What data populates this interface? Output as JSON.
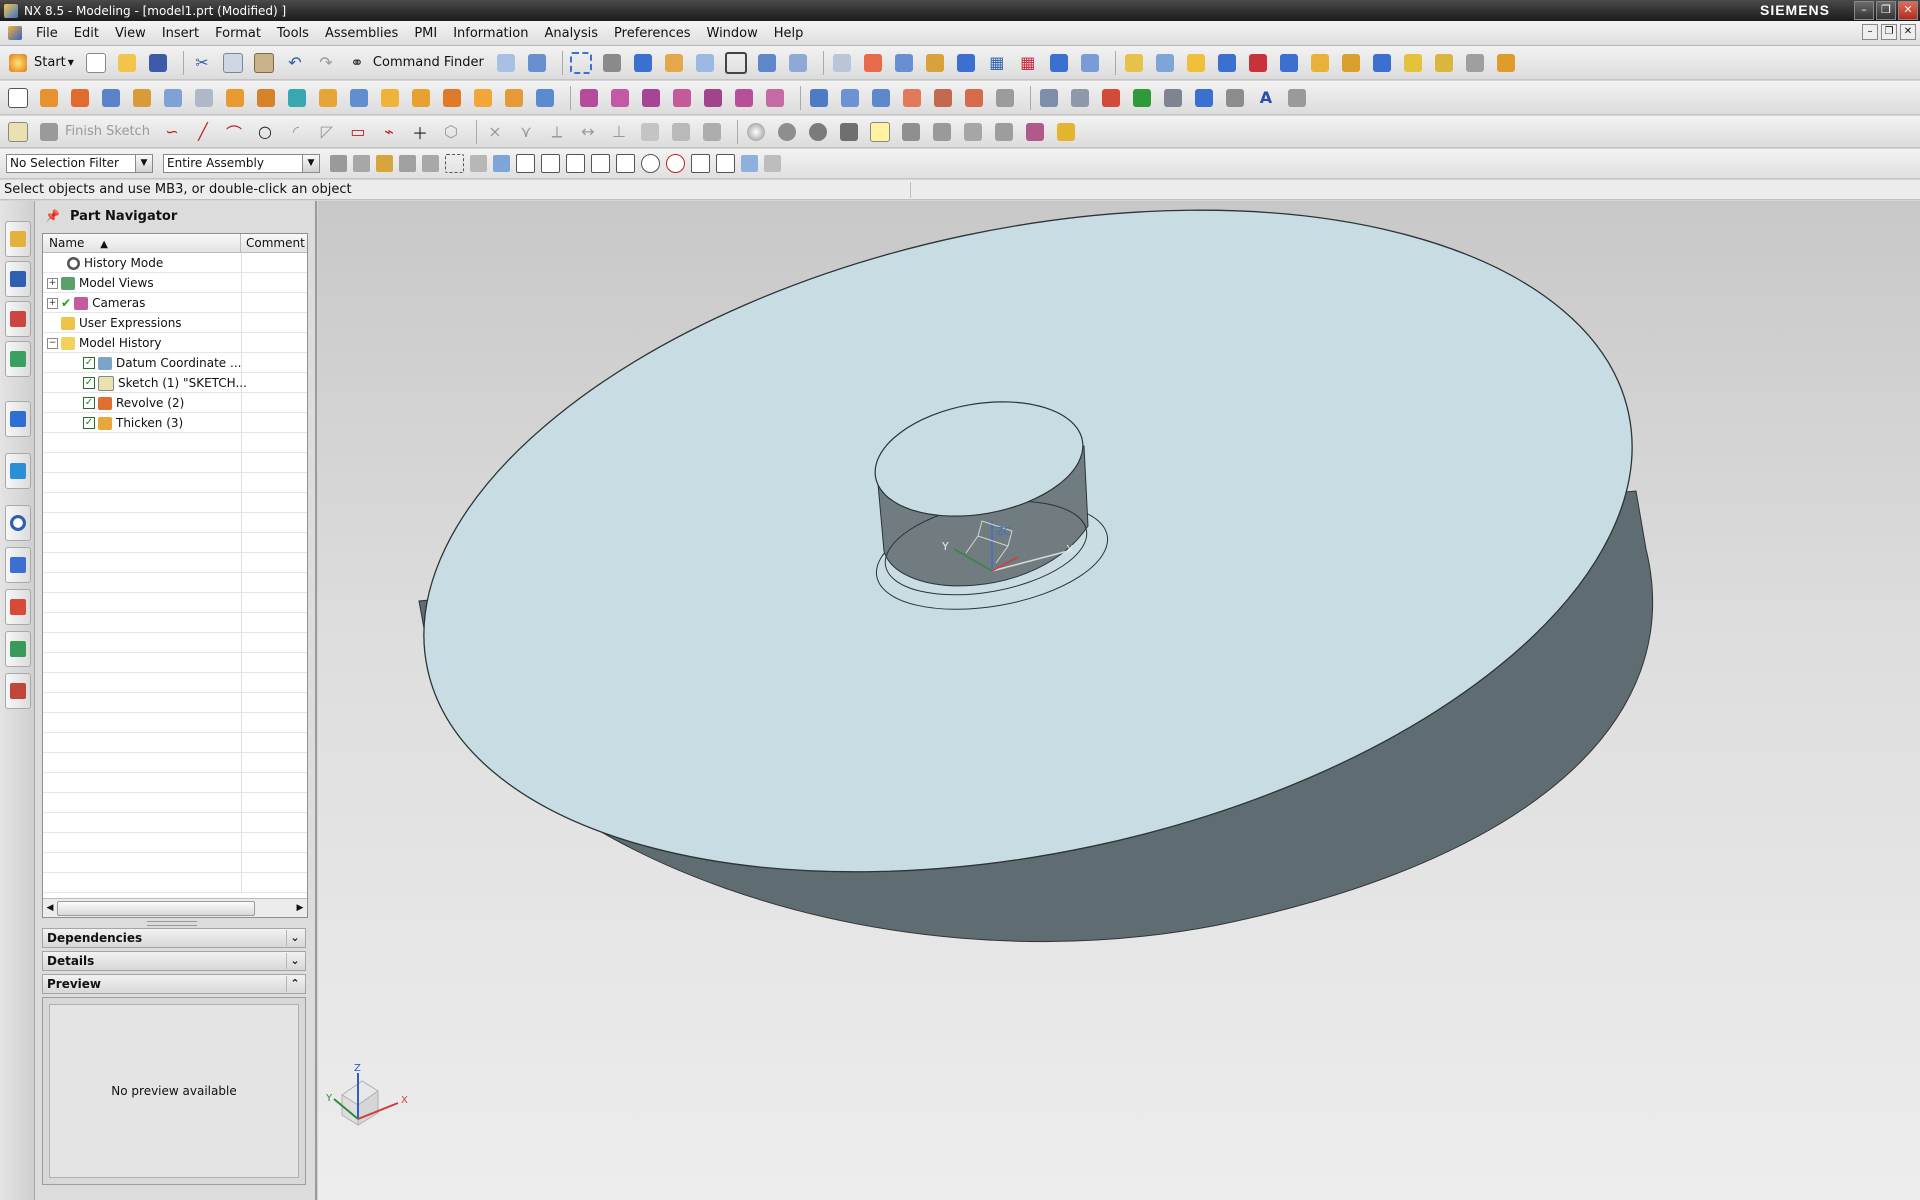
{
  "window": {
    "title": "NX 8.5 - Modeling - [model1.prt (Modified) ]",
    "brand": "SIEMENS"
  },
  "menubar": {
    "items": [
      "File",
      "Edit",
      "View",
      "Insert",
      "Format",
      "Tools",
      "Assemblies",
      "PMI",
      "Information",
      "Analysis",
      "Preferences",
      "Window",
      "Help"
    ]
  },
  "toolbar": {
    "start_label": "Start",
    "command_finder_label": "Command Finder",
    "finish_sketch_label": "Finish Sketch"
  },
  "selection_bar": {
    "filter_value": "No Selection Filter",
    "scope_value": "Entire Assembly"
  },
  "cue_line": "Select objects and use MB3, or double-click an object",
  "part_navigator": {
    "title": "Part Navigator",
    "columns": {
      "name": "Name",
      "comment": "Comment"
    },
    "rows": [
      {
        "label": "History Mode",
        "icon": "clock-icon"
      },
      {
        "label": "Model Views",
        "icon": "model-views-icon"
      },
      {
        "label": "Cameras",
        "icon": "camera-icon"
      },
      {
        "label": "User Expressions",
        "icon": "folder-icon"
      },
      {
        "label": "Model History",
        "icon": "folder-open-icon"
      },
      {
        "label": "Datum Coordinate ...",
        "icon": "datum-csys-icon"
      },
      {
        "label": "Sketch (1) \"SKETCH...",
        "icon": "sketch-icon"
      },
      {
        "label": "Revolve (2)",
        "icon": "revolve-icon"
      },
      {
        "label": "Thicken (3)",
        "icon": "thicken-icon"
      }
    ],
    "panels": {
      "dependencies": "Dependencies",
      "details": "Details",
      "preview": "Preview",
      "preview_message": "No preview available"
    }
  },
  "viewport": {
    "triad_labels": {
      "x": "X",
      "y": "Y",
      "z": "Z"
    },
    "wcs_labels": {
      "x": "X",
      "y": "Y",
      "z": "ZC"
    },
    "colors": {
      "face": "#c7dde3",
      "side": "#5f6d72",
      "background": "#e2e2e2"
    }
  }
}
